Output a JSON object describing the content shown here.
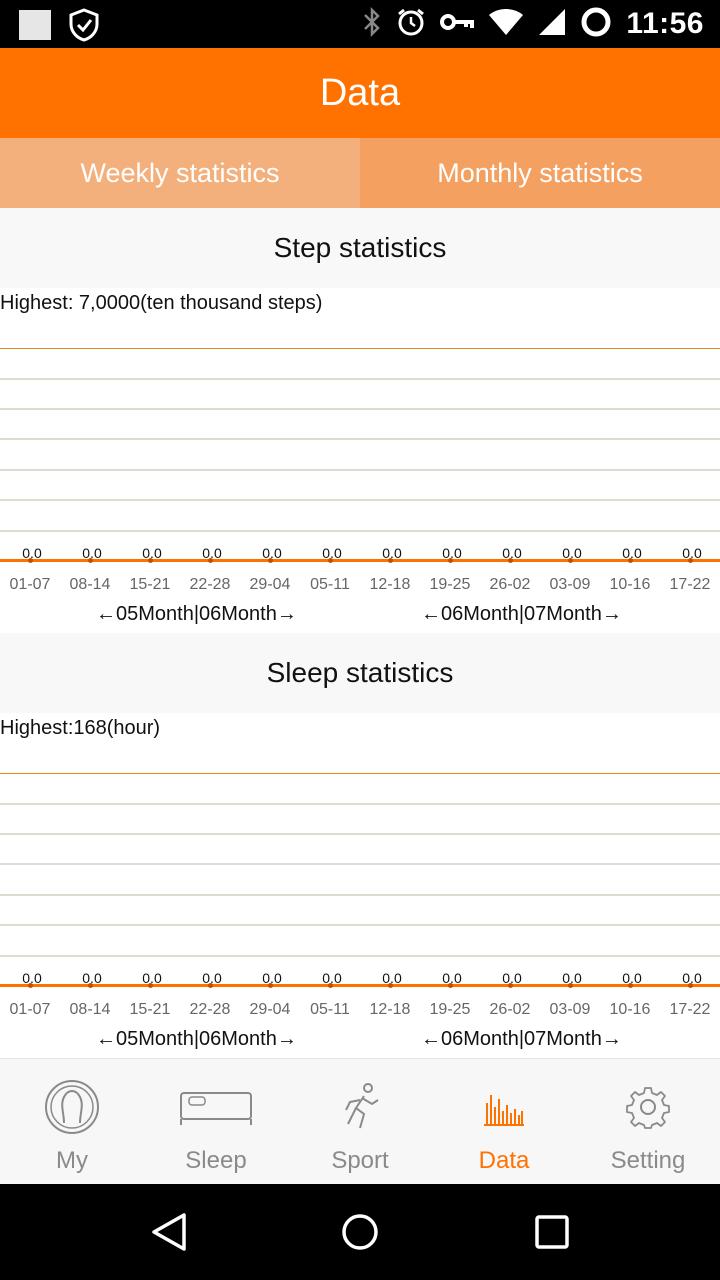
{
  "status_bar": {
    "time": "11:56",
    "icons": [
      "notification-square-icon",
      "shield-check-icon",
      "bluetooth-icon",
      "alarm-icon",
      "vpn-key-icon",
      "wifi-icon",
      "cell-signal-icon",
      "sync-circle-icon"
    ]
  },
  "app_bar": {
    "title": "Data"
  },
  "tabs": {
    "weekly": "Weekly statistics",
    "monthly": "Monthly statistics"
  },
  "step": {
    "title": "Step statistics",
    "highest": "Highest:  7,0000(ten thousand steps)",
    "values": [
      "0.0",
      "0.0",
      "0.0",
      "0.0",
      "0.0",
      "0.0",
      "0.0",
      "0.0",
      "0.0",
      "0.0",
      "0.0",
      "0.0"
    ],
    "weeks": [
      "01-07",
      "08-14",
      "15-21",
      "22-28",
      "29-04",
      "05-11",
      "12-18",
      "19-25",
      "26-02",
      "03-09",
      "10-16",
      "17-22"
    ],
    "month_left": "←05Month|06Month→",
    "month_right": "←06Month|07Month→"
  },
  "sleep": {
    "title": "Sleep statistics",
    "highest": "Highest:168(hour)",
    "values": [
      "0.0",
      "0.0",
      "0.0",
      "0.0",
      "0.0",
      "0.0",
      "0.0",
      "0.0",
      "0.0",
      "0.0",
      "0.0",
      "0.0"
    ],
    "weeks": [
      "01-07",
      "08-14",
      "15-21",
      "22-28",
      "29-04",
      "05-11",
      "12-18",
      "19-25",
      "26-02",
      "03-09",
      "10-16",
      "17-22"
    ],
    "month_left": "←05Month|06Month→",
    "month_right": "←06Month|07Month→"
  },
  "nav": {
    "my": "My",
    "sleep": "Sleep",
    "sport": "Sport",
    "data": "Data",
    "setting": "Setting"
  },
  "colors": {
    "accent": "#ff7200",
    "tab_weekly": "#f4b07c",
    "tab_monthly": "#f4a060",
    "inactive": "#8a8a8a"
  }
}
